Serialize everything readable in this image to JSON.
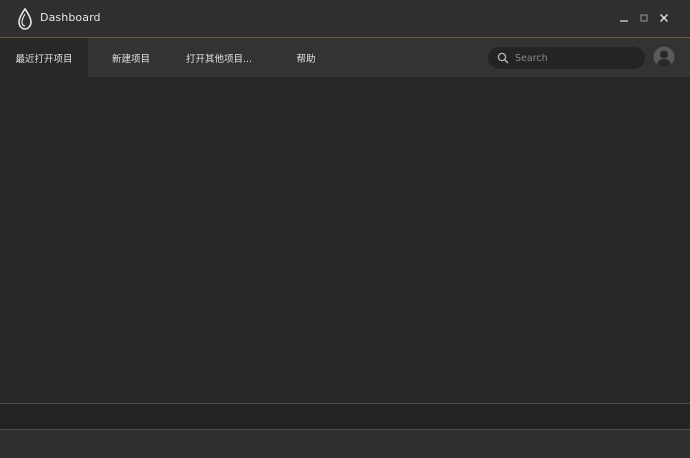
{
  "window": {
    "title": "Dashboard",
    "logo_icon": "drop-logo-icon",
    "controls": {
      "minimize_icon": "minimize-icon",
      "maximize_icon": "maximize-icon",
      "close_icon": "close-icon"
    }
  },
  "nav": {
    "items": [
      {
        "label": "最近打开项目",
        "active": true
      },
      {
        "label": "新建项目",
        "active": false
      },
      {
        "label": "打开其他项目...",
        "active": false
      },
      {
        "label": "帮助",
        "active": false
      }
    ]
  },
  "search": {
    "placeholder": "Search",
    "value": ""
  },
  "user": {
    "avatar_icon": "user-avatar-icon"
  },
  "colors": {
    "titlebar_bg": "#2f2f2f",
    "titlebar_accent_line": "#6b5a42",
    "navbar_bg": "#333333",
    "content_bg": "#282828",
    "text": "#e0e0e0"
  }
}
